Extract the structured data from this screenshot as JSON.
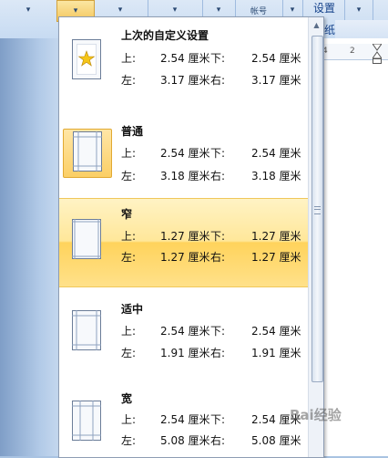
{
  "ribbon": {
    "label_settings": "设置",
    "label_paper": "纸",
    "label_partial": "帐号"
  },
  "ruler": {
    "tick_4": "4",
    "tick_2": "2"
  },
  "margins_menu": {
    "items": [
      {
        "title": "上次的自定义设置",
        "top_label": "上:",
        "top_value": "2.54 厘米",
        "bottom_label": "下:",
        "bottom_value": "2.54 厘米",
        "left_label": "左:",
        "left_value": "3.17 厘米",
        "right_label": "右:",
        "right_value": "3.17 厘米"
      },
      {
        "title": "普通",
        "top_label": "上:",
        "top_value": "2.54 厘米",
        "bottom_label": "下:",
        "bottom_value": "2.54 厘米",
        "left_label": "左:",
        "left_value": "3.18 厘米",
        "right_label": "右:",
        "right_value": "3.18 厘米"
      },
      {
        "title": "窄",
        "top_label": "上:",
        "top_value": "1.27 厘米",
        "bottom_label": "下:",
        "bottom_value": "1.27 厘米",
        "left_label": "左:",
        "left_value": "1.27 厘米",
        "right_label": "右:",
        "right_value": "1.27 厘米"
      },
      {
        "title": "适中",
        "top_label": "上:",
        "top_value": "2.54 厘米",
        "bottom_label": "下:",
        "bottom_value": "2.54 厘米",
        "left_label": "左:",
        "left_value": "1.91 厘米",
        "right_label": "右:",
        "right_value": "1.91 厘米"
      },
      {
        "title": "宽",
        "top_label": "上:",
        "top_value": "2.54 厘米",
        "bottom_label": "下:",
        "bottom_value": "2.54 厘米",
        "left_label": "左:",
        "left_value": "5.08 厘米",
        "right_label": "右:",
        "right_value": "5.08 厘米"
      }
    ]
  },
  "watermark": "Bai经验",
  "colors": {
    "selected_highlight": "#ffd35c",
    "ribbon_blue": "#c7dbf2",
    "star": "#f5c518"
  }
}
